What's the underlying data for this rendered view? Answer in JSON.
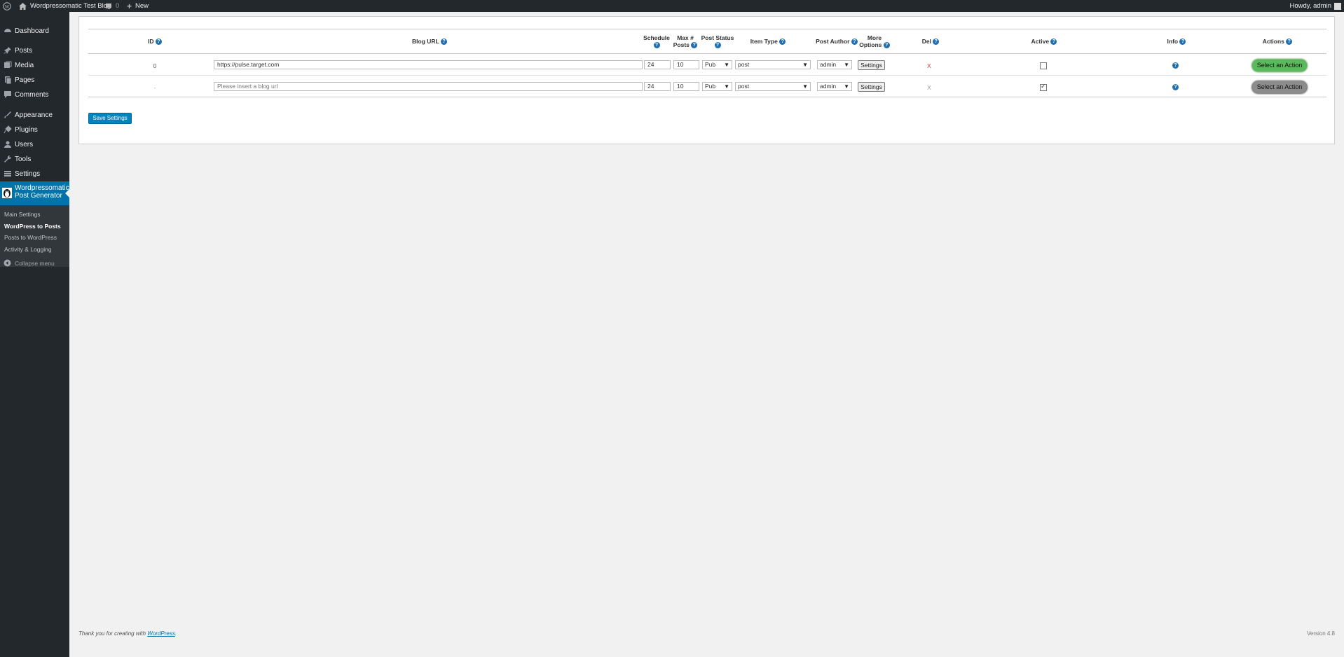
{
  "adminbar": {
    "site_name": "Wordpressomatic Test Blog",
    "comments_count": "0",
    "new_label": "New",
    "howdy": "Howdy, admin"
  },
  "sidebar": {
    "items": [
      {
        "label": "Dashboard",
        "icon": "dashboard-icon"
      },
      {
        "label": "Posts",
        "icon": "pin-icon"
      },
      {
        "label": "Media",
        "icon": "media-icon"
      },
      {
        "label": "Pages",
        "icon": "pages-icon"
      },
      {
        "label": "Comments",
        "icon": "comment-icon"
      },
      {
        "label": "Appearance",
        "icon": "brush-icon"
      },
      {
        "label": "Plugins",
        "icon": "plug-icon"
      },
      {
        "label": "Users",
        "icon": "user-icon"
      },
      {
        "label": "Tools",
        "icon": "wrench-icon"
      },
      {
        "label": "Settings",
        "icon": "settings-icon"
      }
    ],
    "current": {
      "line1": "Wordpressomatic",
      "line2": "Post Generator",
      "icon": "penguin-icon"
    },
    "submenu": [
      {
        "label": "Main Settings"
      },
      {
        "label": "WordPress to Posts"
      },
      {
        "label": "Posts to WordPress"
      },
      {
        "label": "Activity & Logging"
      }
    ],
    "collapse_label": "Collapse menu"
  },
  "table": {
    "headers": {
      "id": "ID",
      "blog_url": "Blog URL",
      "schedule": "Schedule",
      "max_posts_1": "Max #",
      "max_posts_2": "Posts",
      "post_status": "Post Status",
      "item_type": "Item Type",
      "post_author": "Post Author",
      "more_options_1": "More",
      "more_options_2": "Options",
      "del": "Del",
      "active": "Active",
      "info": "Info",
      "actions": "Actions"
    },
    "help_glyph": "?",
    "rows": [
      {
        "id": "0",
        "blog_url": "https://pulse.target.com",
        "blog_url_placeholder": "",
        "schedule": "24",
        "max_posts": "10",
        "post_status": "Pub",
        "item_type": "post",
        "post_author": "admin",
        "settings_label": "Settings",
        "del": "X",
        "active": false,
        "action_label": "Select an Action",
        "action_color": "#5cb85c"
      },
      {
        "id": "-",
        "blog_url": "",
        "blog_url_placeholder": "Please insert a blog url",
        "schedule": "24",
        "max_posts": "10",
        "post_status": "Pub",
        "item_type": "post",
        "post_author": "admin",
        "settings_label": "Settings",
        "del": "X",
        "active": true,
        "action_label": "Select an Action",
        "action_color": "#8c8c8c"
      }
    ]
  },
  "save_button": "Save Settings",
  "footer": {
    "thanks_prefix": "Thank you for creating with ",
    "thanks_link": "WordPress",
    "thanks_suffix": ".",
    "version": "Version 4.8"
  },
  "colors": {
    "sidebar_bg": "#23282d",
    "accent": "#0073aa",
    "action_green": "#5cb85c"
  }
}
